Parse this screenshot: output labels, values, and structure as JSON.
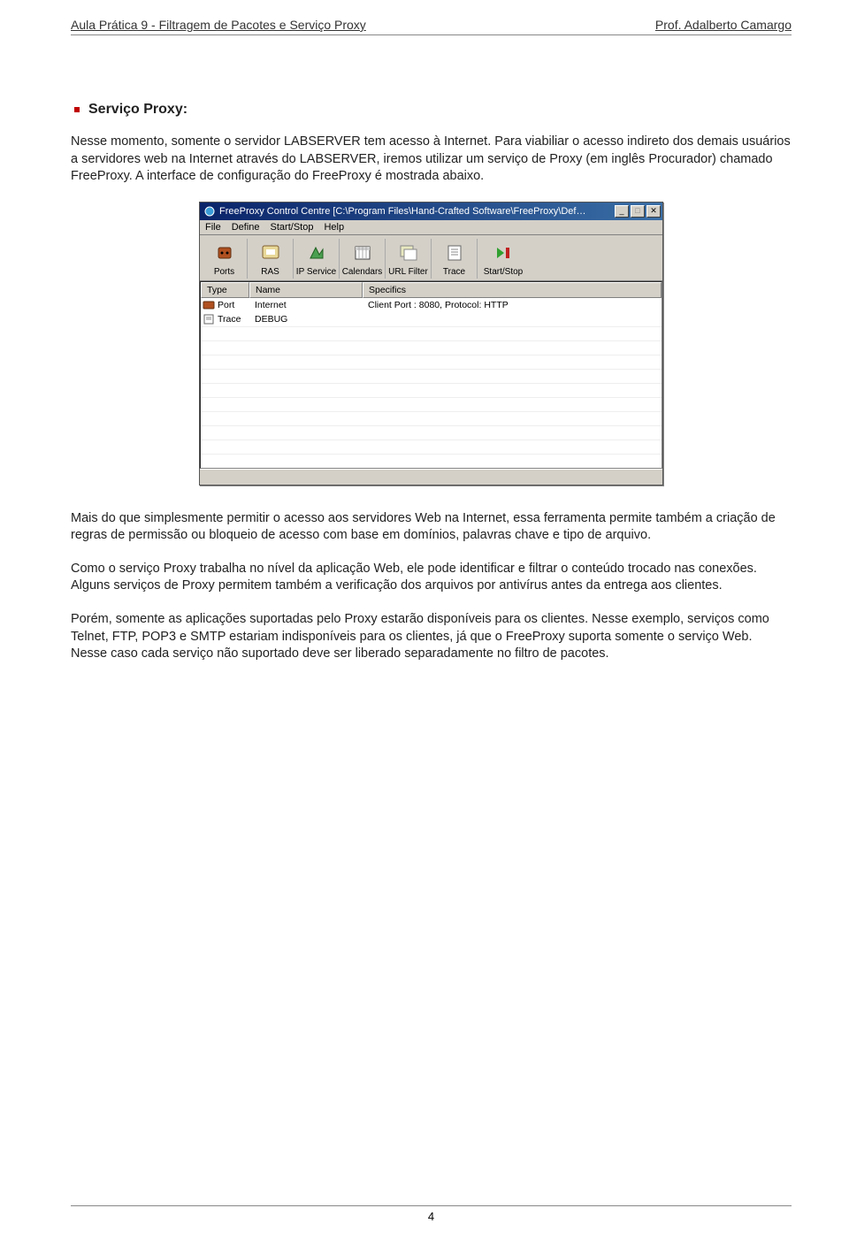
{
  "header": {
    "left": "Aula Prática 9 - Filtragem de Pacotes e Serviço Proxy",
    "right": "Prof. Adalberto Camargo"
  },
  "section_title": "Serviço Proxy:",
  "paragraphs": {
    "p1": "Nesse momento, somente o servidor LABSERVER tem acesso à Internet. Para viabiliar o acesso indireto dos demais usuários a servidores web na Internet através do LABSERVER, iremos utilizar um serviço de Proxy (em inglês Procurador) chamado FreeProxy. A interface de configuração do FreeProxy é mostrada abaixo.",
    "p2": "Mais do que simplesmente permitir o acesso aos servidores Web na Internet, essa ferramenta permite também a criação de regras de permissão ou bloqueio de acesso com base em domínios, palavras chave e tipo de arquivo.",
    "p3": "Como o serviço Proxy trabalha no nível da aplicação Web, ele pode identificar e filtrar o conteúdo trocado nas conexões. Alguns serviços de Proxy permitem também a verificação dos arquivos por antivírus antes da entrega aos clientes.",
    "p4": "Porém, somente as aplicações suportadas pelo Proxy estarão disponíveis para os clientes. Nesse exemplo, serviços como Telnet, FTP, POP3 e SMTP estariam indisponíveis para os clientes, já que o FreeProxy suporta somente o serviço Web. Nesse caso cada serviço não suportado deve ser liberado separadamente no filtro de pacotes."
  },
  "app": {
    "title": "FreeProxy Control Centre  [C:\\Program Files\\Hand-Crafted Software\\FreeProxy\\Def…",
    "menus": [
      "File",
      "Define",
      "Start/Stop",
      "Help"
    ],
    "toolbar": [
      {
        "label": "Ports"
      },
      {
        "label": "RAS"
      },
      {
        "label": "IP Service"
      },
      {
        "label": "Calendars"
      },
      {
        "label": "URL Filter"
      },
      {
        "label": "Trace"
      },
      {
        "label": "Start/Stop"
      }
    ],
    "columns": {
      "type": "Type",
      "name": "Name",
      "specifics": "Specifics"
    },
    "rows": [
      {
        "type": "Port",
        "name": "Internet",
        "specifics": "Client Port : 8080, Protocol: HTTP"
      },
      {
        "type": "Trace",
        "name": "DEBUG",
        "specifics": ""
      }
    ]
  },
  "page_number": "4"
}
